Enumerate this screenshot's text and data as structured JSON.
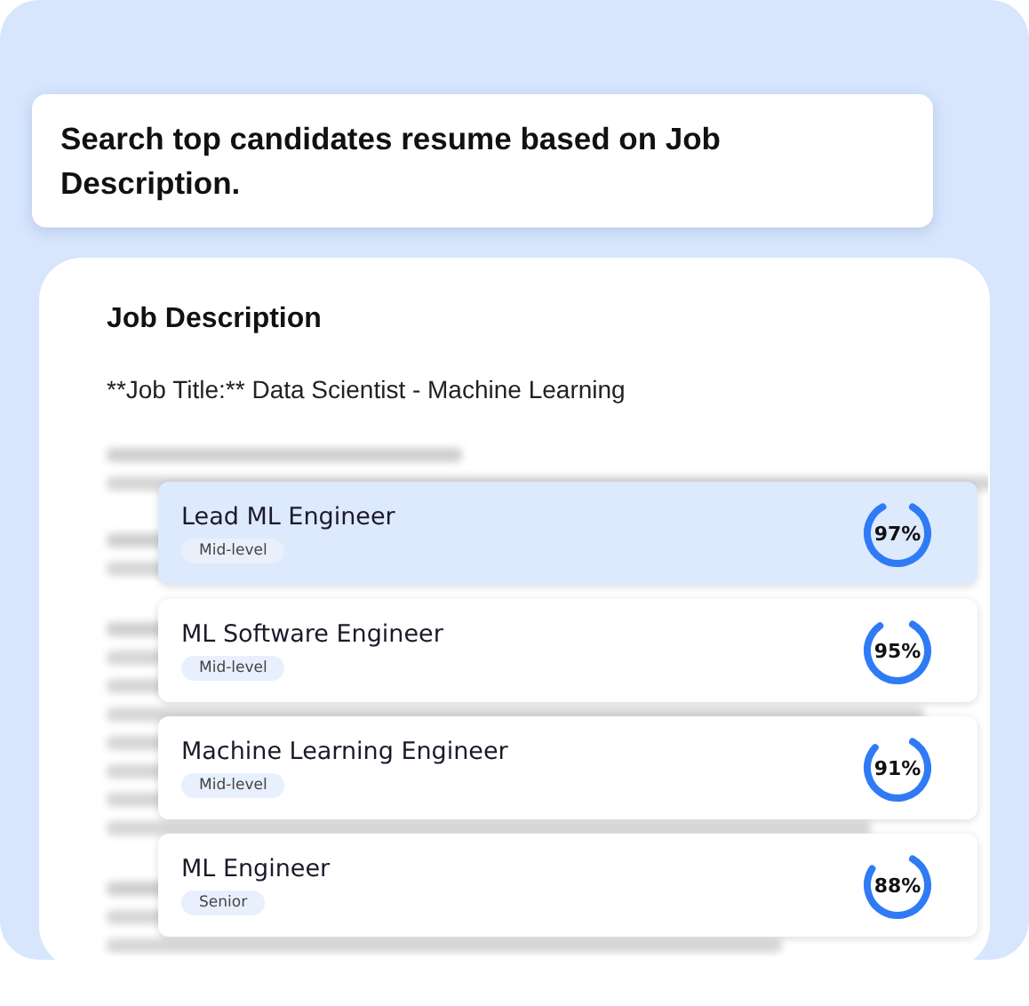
{
  "prompt": {
    "text": "Search top candidates resume based on Job Description."
  },
  "job_description": {
    "heading": "Job Description",
    "job_title": "**Job Title:** Data Scientist - Machine Learning"
  },
  "candidates": [
    {
      "title": "Lead ML Engineer",
      "level_tag": "Mid-level",
      "score": "97%",
      "level": 0.97,
      "selected": true
    },
    {
      "title": "ML Software Engineer",
      "level_tag": "Mid-level",
      "score": "95%",
      "level": 0.95,
      "selected": false
    },
    {
      "title": "Machine Learning Engineer",
      "level_tag": "Mid-level",
      "score": "91%",
      "level": 0.91,
      "selected": false
    },
    {
      "title": "ML Engineer",
      "level_tag": "Senior",
      "score": "88%",
      "level": 0.88,
      "selected": false
    }
  ]
}
